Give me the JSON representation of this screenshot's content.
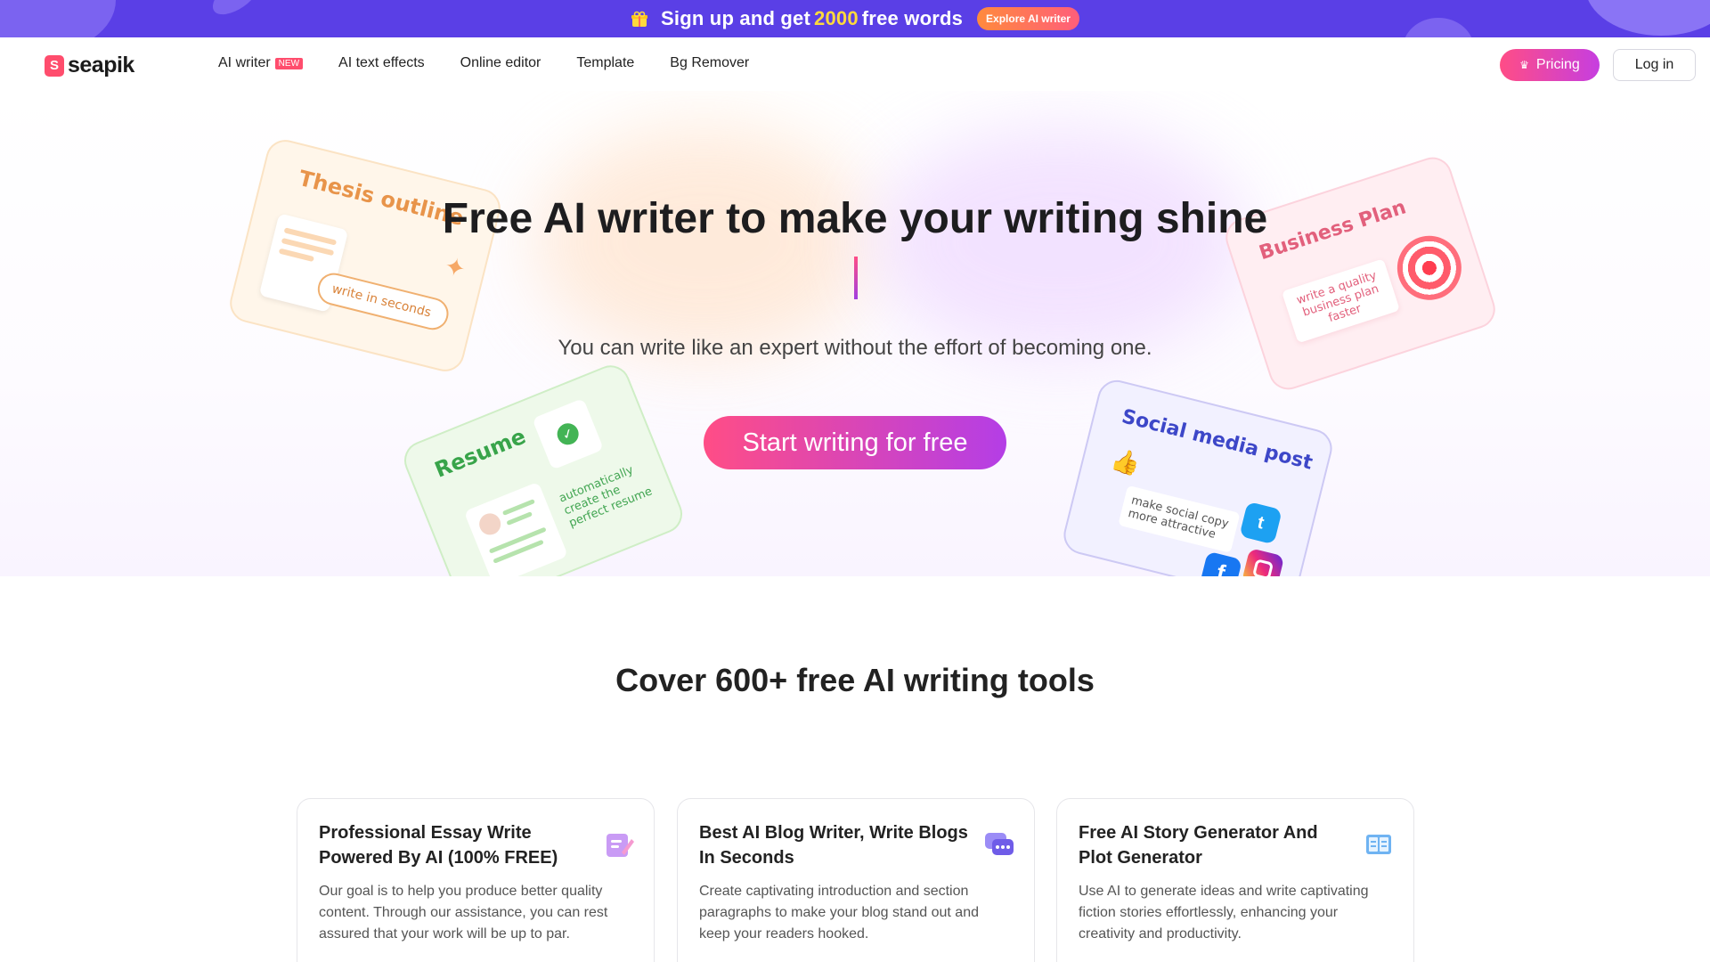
{
  "banner": {
    "text_before": "Sign up and get",
    "highlight": "2000",
    "text_after": "free words",
    "button": "Explore AI writer"
  },
  "nav": {
    "logo_mark": "S",
    "logo_text": "seapik",
    "items": [
      {
        "label": "AI writer",
        "badge": "NEW"
      },
      {
        "label": "AI text effects"
      },
      {
        "label": "Online editor"
      },
      {
        "label": "Template"
      },
      {
        "label": "Bg Remover"
      }
    ],
    "pricing": "Pricing",
    "login": "Log in"
  },
  "hero": {
    "title": "Free AI writer to make your writing shine",
    "subtitle": "You can write like an expert without the effort of becoming one.",
    "cta": "Start writing for free",
    "cards": {
      "thesis": {
        "title": "Thesis outline",
        "note": "write in seconds"
      },
      "business": {
        "title": "Business Plan",
        "note": "write a quality business plan faster"
      },
      "resume": {
        "title": "Resume",
        "note": "automatically create the perfect resume"
      },
      "social": {
        "title": "Social media post",
        "note": "make social copy more attractive"
      }
    }
  },
  "tools": {
    "heading": "Cover 600+ free AI writing tools",
    "items": [
      {
        "title": "Professional Essay Write Powered By AI (100% FREE)",
        "desc": "Our goal is to help you produce better quality content. Through our assistance, you can rest assured that your work will be up to par.",
        "icon": "essay-pen-icon"
      },
      {
        "title": "Best AI Blog Writer, Write Blogs In Seconds",
        "desc": "Create captivating introduction and section paragraphs to make your blog stand out and keep your readers hooked.",
        "icon": "chat-bubbles-icon"
      },
      {
        "title": "Free AI Story Generator And Plot Generator",
        "desc": "Use AI to generate ideas and write captivating fiction stories effortlessly, enhancing your creativity and productivity.",
        "icon": "open-book-icon"
      }
    ]
  },
  "colors": {
    "banner": "#5a3fe6",
    "accent_pink": "#ff4d86",
    "accent_purple": "#b43ee6",
    "highlight_yellow": "#ffd93d"
  }
}
